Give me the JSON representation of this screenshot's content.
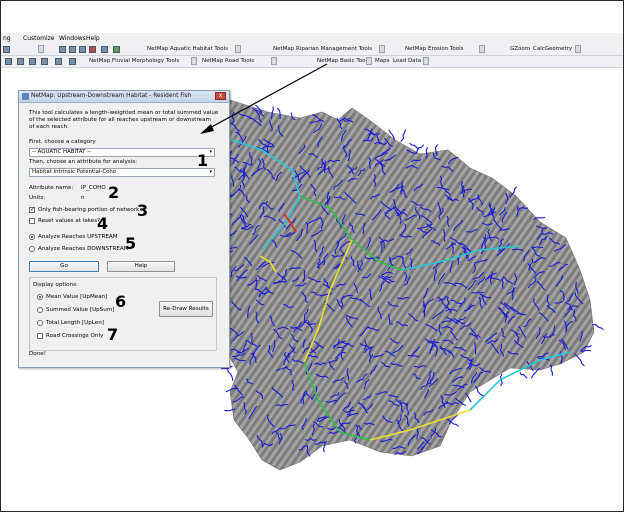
{
  "menubar": {
    "items": [
      "ng",
      "Customize",
      "Windows",
      "Help"
    ]
  },
  "toolbar_row1": {
    "aquatic_tools": "NetMap Aquatic Habitat Tools",
    "riparian_tools": "NetMap Riparian Management Tools",
    "erosion_tools": "NetMap Erosion Tools",
    "gzoom": "GZoom",
    "calcgeometry": "CalcGeometry"
  },
  "toolbar_row2": {
    "fluvial_tools": "NetMap Fluvial Morphology Tools",
    "road_tools": "NetMap Road Tools",
    "basic_tools": "NetMap Basic Tools",
    "maps": "Maps",
    "load_data": "Load Data"
  },
  "dialog": {
    "title": "NetMap: Upstream-Downstream Habitat - Resident Fish",
    "close_glyph": "x",
    "description_lines": [
      "This tool calculates a length-weighted mean or total summed value",
      "of the selected attribute for all reaches upstream or downstream",
      "of each reach."
    ],
    "category_label": "First, choose a category",
    "category_value": "-- AQUATIC HABITAT --",
    "attribute_label": "Then, choose an attribute for analysis:",
    "attribute_value": "Habitat Intrinsic Potential-Coho",
    "attribute_name_label": "Attribute name:",
    "attribute_name_value": "IP_COHO",
    "units_label": "Units:",
    "units_value": "n",
    "fish_bearing_label": "Only fish-bearing portion of network",
    "fish_bearing_checked": true,
    "reset_lakes_label": "Reset values at lakes?",
    "reset_lakes_checked": false,
    "upstream_label": "Analyze Reaches UPSTREAM",
    "upstream_selected": true,
    "downstream_label": "Analyze Reaches DOWNSTREAM",
    "go_label": "Go",
    "help_label": "Help",
    "display_options_label": "Display options:",
    "mean_label": "Mean Value [UpMean]",
    "summed_label": "Summed Value [UpSum]",
    "total_length_label": "Total Length [UpLen]",
    "road_crossings_label": "Road Crossings Only",
    "redraw_label": "Re-Draw Results",
    "status": "Done!",
    "check_glyph": "✓",
    "dropdown_glyph": "▾"
  },
  "callouts": [
    "1",
    "2",
    "3",
    "4",
    "5",
    "6",
    "7"
  ],
  "colors": {
    "stream_network": "#1a1ad6",
    "terrain": "#9c9c9c",
    "high_habitat": "#e8e02a",
    "mid_habitat": "#2fbf4a",
    "low_habitat": "#26c7d9",
    "peak_habitat": "#e0281c"
  }
}
